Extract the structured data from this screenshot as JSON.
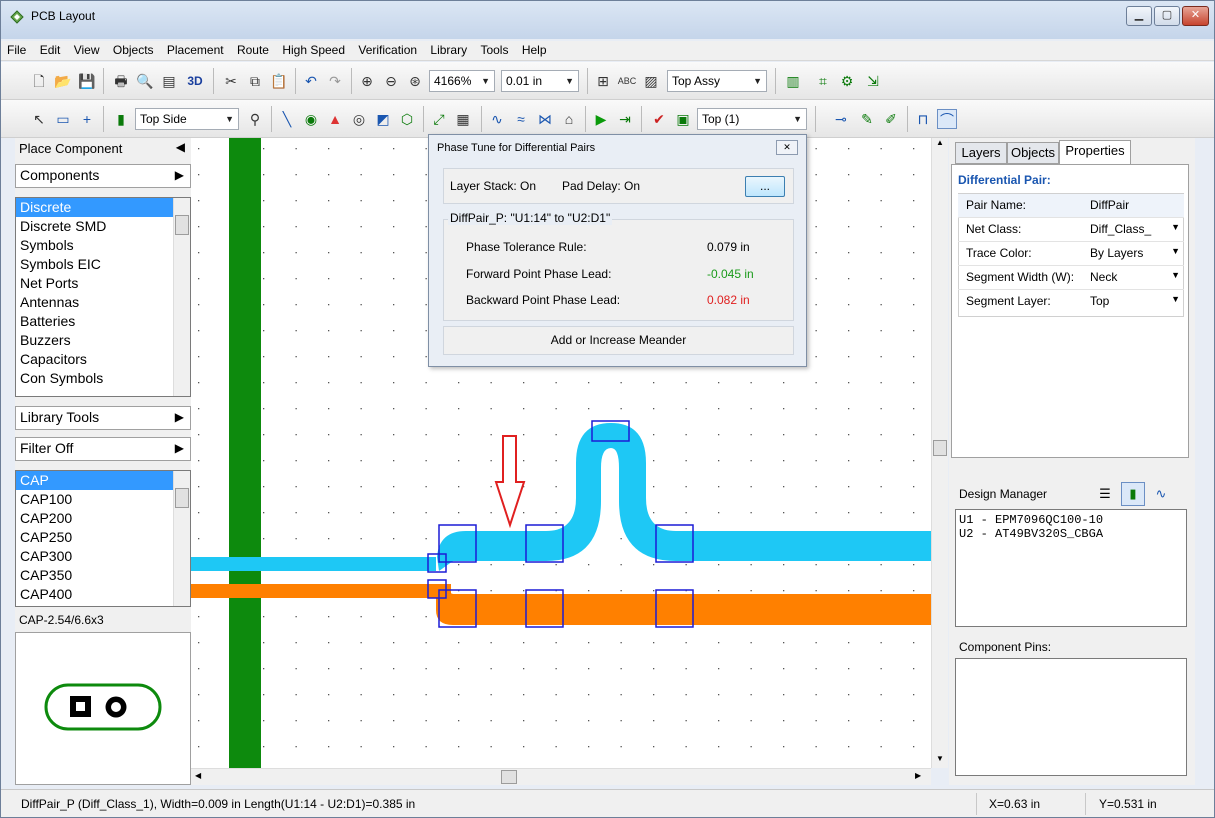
{
  "window": {
    "title": "PCB Layout",
    "buttons": [
      "minimize",
      "maximize",
      "close"
    ]
  },
  "menubar": [
    "File",
    "Edit",
    "View",
    "Objects",
    "Placement",
    "Route",
    "High Speed",
    "Verification",
    "Library",
    "Tools",
    "Help"
  ],
  "toolbar1": {
    "zoom": "4166%",
    "grid": "0.01 in",
    "view_3d": "3D",
    "assembly": "Top Assy"
  },
  "toolbar2": {
    "side": "Top Side",
    "layer": "Top (1)"
  },
  "left_panel": {
    "place_component": "Place Component",
    "components_header": "Components",
    "component_categories": [
      "Discrete",
      "Discrete SMD",
      "Symbols",
      "Symbols EIC",
      "Net Ports",
      "Antennas",
      "Batteries",
      "Buzzers",
      "Capacitors",
      "Con Symbols"
    ],
    "selected_category": "Discrete",
    "library_tools": "Library Tools",
    "filter": "Filter Off",
    "parts": [
      "CAP",
      "CAP100",
      "CAP200",
      "CAP250",
      "CAP300",
      "CAP350",
      "CAP400"
    ],
    "selected_part": "CAP",
    "footprint_name": "CAP-2.54/6.6x3"
  },
  "dialog": {
    "title": "Phase Tune for Differential Pairs",
    "layer_stack": "Layer Stack: On",
    "pad_delay": "Pad Delay: On",
    "browse_label": "...",
    "pair_group": "DiffPair_P:  \"U1:14\" to \"U2:D1\"",
    "rows": [
      {
        "label": "Phase Tolerance Rule:",
        "value": "0.079 in",
        "color": "#000000"
      },
      {
        "label": "Forward Point Phase Lead:",
        "value": "-0.045 in",
        "color": "#1a9a1a"
      },
      {
        "label": "Backward Point Phase Lead:",
        "value": "0.082 in",
        "color": "#e02020"
      }
    ],
    "action": "Add or Increase Meander"
  },
  "right_panel": {
    "tabs": [
      "Layers",
      "Objects",
      "Properties"
    ],
    "active_tab": "Properties",
    "section_title": "Differential Pair:",
    "properties": [
      {
        "name": "Pair Name:",
        "value": "DiffPair",
        "dropdown": false
      },
      {
        "name": "Net Class:",
        "value": "Diff_Class_",
        "dropdown": true
      },
      {
        "name": "Trace Color:",
        "value": "By Layers",
        "dropdown": true
      },
      {
        "name": "Segment Width (W):",
        "value": "Neck",
        "dropdown": true
      },
      {
        "name": "Segment Layer:",
        "value": "Top",
        "dropdown": true
      }
    ],
    "design_manager": "Design Manager",
    "design_items": [
      "U1 - EPM7096QC100-10",
      "U2 - AT49BV320S_CBGA"
    ],
    "component_pins": "Component Pins:"
  },
  "status": {
    "info": "DiffPair_P (Diff_Class_1), Width=0.009 in  Length(U1:14 - U2:D1)=0.385 in",
    "x": "X=0.63 in",
    "y": "Y=0.531 in"
  },
  "colors": {
    "trace_green": "#0d8a0d",
    "trace_cyan": "#1ec8f5",
    "trace_orange": "#ff8000",
    "pad_outline": "#1c1cd6",
    "arrow_red": "#e02020",
    "accent_blue": "#1a56b0",
    "selection": "#3399ff"
  }
}
